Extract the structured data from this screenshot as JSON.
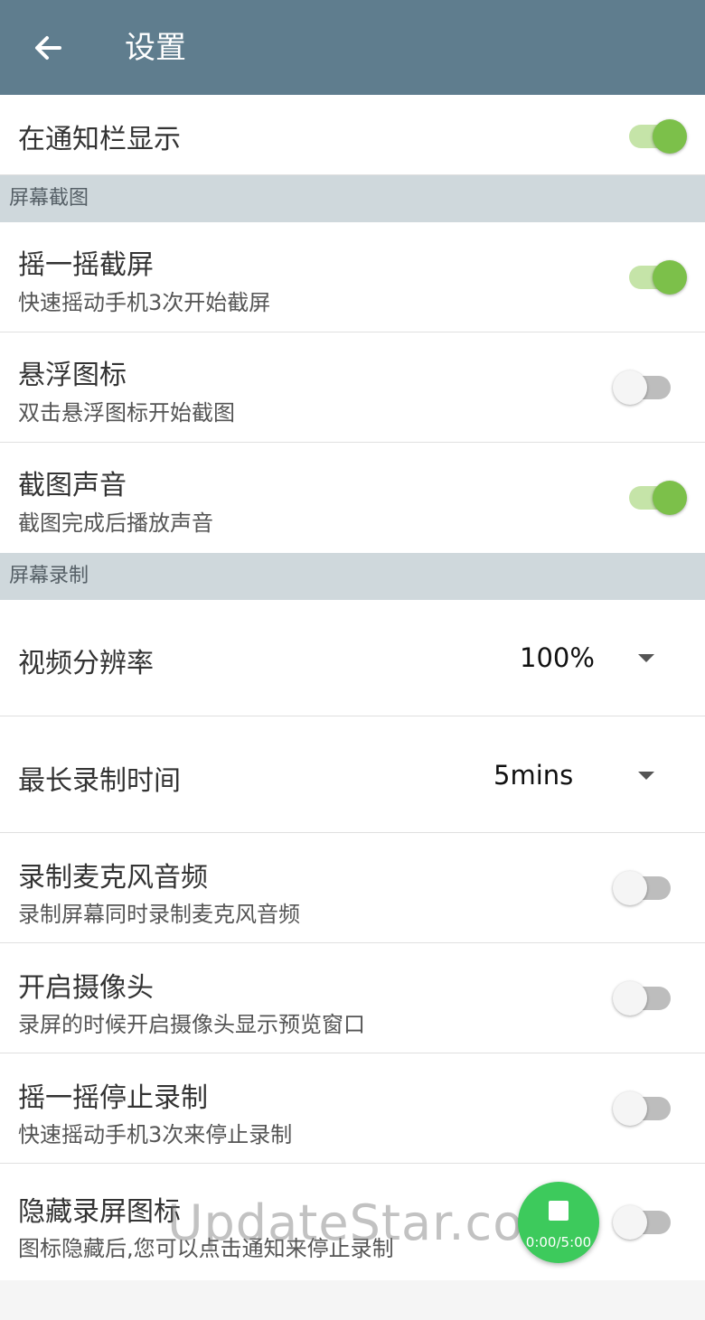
{
  "appbar": {
    "title": "设置",
    "back_icon": "arrow-left-icon"
  },
  "notification": {
    "title": "在通知栏显示",
    "enabled": true
  },
  "sections": {
    "screenshot": "屏幕截图",
    "recording": "屏幕录制"
  },
  "shake_screenshot": {
    "title": "摇一摇截屏",
    "subtitle": "快速摇动手机3次开始截屏",
    "enabled": true
  },
  "float_icon": {
    "title": "悬浮图标",
    "subtitle": "双击悬浮图标开始截图",
    "enabled": false
  },
  "screenshot_sound": {
    "title": "截图声音",
    "subtitle": "截图完成后播放声音",
    "enabled": true
  },
  "resolution": {
    "title": "视频分辨率",
    "value": "100%"
  },
  "max_time": {
    "title": "最长录制时间",
    "value": "5mins"
  },
  "mic_audio": {
    "title": "录制麦克风音频",
    "subtitle": "录制屏幕同时录制麦克风音频",
    "enabled": false
  },
  "camera": {
    "title": "开启摄像头",
    "subtitle": "录屏的时候开启摄像头显示预览窗口",
    "enabled": false
  },
  "shake_stop": {
    "title": "摇一摇停止录制",
    "subtitle": "快速摇动手机3次来停止录制",
    "enabled": false
  },
  "hide_icon": {
    "title": "隐藏录屏图标",
    "subtitle": "图标隐藏后,您可以点击通知来停止录制",
    "enabled": false
  },
  "watermark": "UpdateStar.com",
  "fab": {
    "time": "0:00/5:00",
    "icon": "stop-icon"
  },
  "colors": {
    "appbar": "#5f7d8e",
    "accent": "#7cc04a",
    "section_bg": "#cfd8dc",
    "fab": "#3dca5c"
  }
}
